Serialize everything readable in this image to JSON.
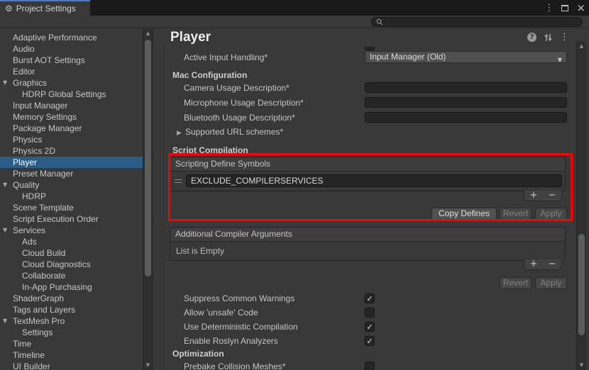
{
  "icons": {
    "gear": "⚙",
    "kebab": "⋮",
    "close": "×",
    "search": "magnifier",
    "up": "▲",
    "down": "▼",
    "expanded": "▼",
    "collapsed": "▶",
    "check": "✓",
    "plus": "+",
    "minus": "−",
    "help": "?"
  },
  "colors": {
    "background": "#383838",
    "titlebar": "#191919",
    "tab_accent": "#4A7CC2",
    "selection_blue": "#2C5D87",
    "highlight_red": "#FF0000",
    "field_bg": "#252525",
    "button_bg": "#515151"
  },
  "window": {
    "tab_title": "Project Settings"
  },
  "search": {
    "placeholder": "",
    "value": ""
  },
  "sidebar": {
    "items": [
      {
        "label": "Adaptive Performance",
        "indent": 0
      },
      {
        "label": "Audio",
        "indent": 0
      },
      {
        "label": "Burst AOT Settings",
        "indent": 0
      },
      {
        "label": "Editor",
        "indent": 0
      },
      {
        "label": "Graphics",
        "indent": 0,
        "expanded": true
      },
      {
        "label": "HDRP Global Settings",
        "indent": 1
      },
      {
        "label": "Input Manager",
        "indent": 0
      },
      {
        "label": "Memory Settings",
        "indent": 0
      },
      {
        "label": "Package Manager",
        "indent": 0
      },
      {
        "label": "Physics",
        "indent": 0
      },
      {
        "label": "Physics 2D",
        "indent": 0
      },
      {
        "label": "Player",
        "indent": 0,
        "selected": true
      },
      {
        "label": "Preset Manager",
        "indent": 0
      },
      {
        "label": "Quality",
        "indent": 0,
        "expanded": true
      },
      {
        "label": "HDRP",
        "indent": 1
      },
      {
        "label": "Scene Template",
        "indent": 0
      },
      {
        "label": "Script Execution Order",
        "indent": 0
      },
      {
        "label": "Services",
        "indent": 0,
        "expanded": true
      },
      {
        "label": "Ads",
        "indent": 1
      },
      {
        "label": "Cloud Build",
        "indent": 1
      },
      {
        "label": "Cloud Diagnostics",
        "indent": 1
      },
      {
        "label": "Collaborate",
        "indent": 1
      },
      {
        "label": "In-App Purchasing",
        "indent": 1
      },
      {
        "label": "ShaderGraph",
        "indent": 0
      },
      {
        "label": "Tags and Layers",
        "indent": 0
      },
      {
        "label": "TextMesh Pro",
        "indent": 0,
        "expanded": true
      },
      {
        "label": "Settings",
        "indent": 1
      },
      {
        "label": "Time",
        "indent": 0
      },
      {
        "label": "Timeline",
        "indent": 0
      },
      {
        "label": "UI Builder",
        "indent": 0
      }
    ]
  },
  "main": {
    "title": "Player",
    "active_input_handling": {
      "label": "Active Input Handling*",
      "value": "Input Manager (Old)"
    },
    "mac_configuration": {
      "header": "Mac Configuration",
      "fields": [
        {
          "label": "Camera Usage Description*",
          "value": ""
        },
        {
          "label": "Microphone Usage Description*",
          "value": ""
        },
        {
          "label": "Bluetooth Usage Description*",
          "value": ""
        }
      ],
      "foldout_label": "Supported URL schemes*"
    },
    "script_compilation": {
      "header": "Script Compilation",
      "scripting_define_symbols": {
        "list_header": "Scripting Define Symbols",
        "items": [
          "EXCLUDE_COMPILERSERVICES"
        ],
        "copy_defines_label": "Copy Defines",
        "revert_label": "Revert",
        "apply_label": "Apply"
      },
      "additional_compiler_arguments": {
        "list_header": "Additional Compiler Arguments",
        "empty_label": "List is Empty",
        "revert_label": "Revert",
        "apply_label": "Apply"
      },
      "checkboxes": [
        {
          "label": "Suppress Common Warnings",
          "checked": true
        },
        {
          "label": "Allow 'unsafe' Code",
          "checked": false
        },
        {
          "label": "Use Deterministic Compilation",
          "checked": true
        },
        {
          "label": "Enable Roslyn Analyzers",
          "checked": true
        }
      ]
    },
    "optimization": {
      "header": "Optimization",
      "checkboxes": [
        {
          "label": "Prebake Collision Meshes*",
          "checked": false
        }
      ]
    }
  }
}
